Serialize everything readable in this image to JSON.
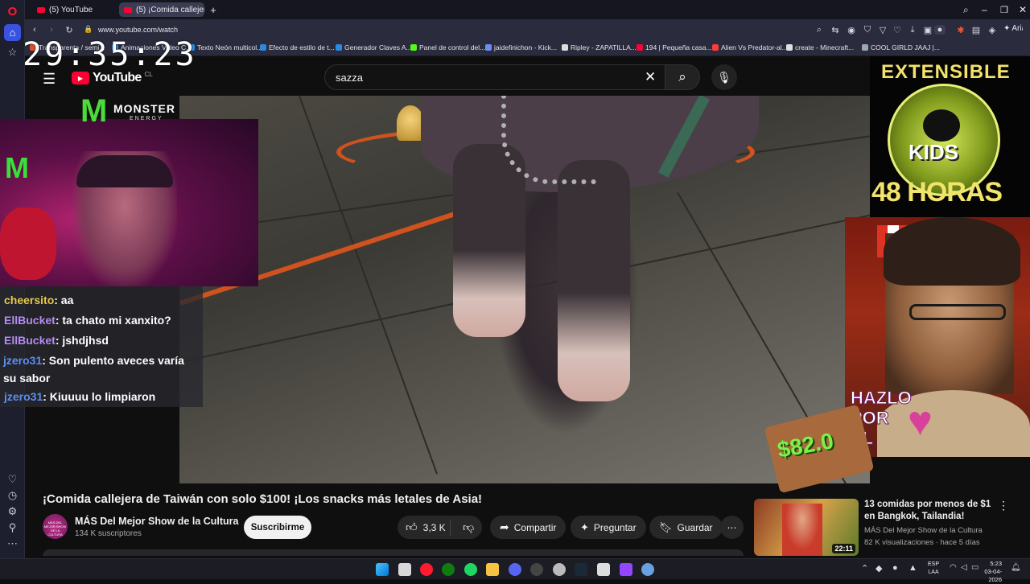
{
  "browser": {
    "tabs": [
      {
        "label": "(5) YouTube",
        "active": false
      },
      {
        "label": "(5) ¡Comida callejera ...",
        "active": true
      }
    ],
    "url": "www.youtube.com/watch",
    "bookmarks": [
      "Transparenta / semi...",
      "Animaciones Video C...",
      "Texto Neón multicol...",
      "Efecto de estilo de t...",
      "Generador Claves A...",
      "Panel de control del...",
      "jaidefinichon - Kick...",
      "Ripley - ZAPATILLA...",
      "194 | Pequeña casa...",
      "Alien Vs Predator-al...",
      "create - Minecraft...",
      "COOL GIRLD JAAJ |..."
    ],
    "ai_label": "Aria"
  },
  "overlay": {
    "clock": "29:35:23",
    "sponsor": "MONSTER",
    "sponsor_sub": "ENERGY",
    "kids_top": "EXTENSIBLE",
    "kids_mid": "KIDS",
    "kids_bottom": "48 HORAS",
    "hazlo": [
      "HAZLO",
      "POR",
      "EL"
    ],
    "money": "$82.0"
  },
  "chat": [
    {
      "user": "cheersito",
      "color": "#e6c84a",
      "text": ": aa"
    },
    {
      "user": "EllBucket",
      "color": "#b58cf0",
      "text": ": ta chato mi xanxito?"
    },
    {
      "user": "EllBucket",
      "color": "#b58cf0",
      "text": ": jshdjhsd"
    },
    {
      "user": "jzero31",
      "color": "#5b8ff0",
      "text": ": Son pulento aveces varía su sabor"
    },
    {
      "user": "jzero31",
      "color": "#5b8ff0",
      "text": ": Kiuuuu lo limpiaron"
    }
  ],
  "youtube": {
    "logo": "YouTube",
    "country": "CL",
    "search_value": "sazza",
    "video_title": "¡Comida callejera de Taiwán con solo $100! ¡Los snacks más letales de Asia!",
    "channel": "MÁS Del Mejor Show de la Cultura",
    "subscribers": "134 K suscriptores",
    "avatar_text": "MÁS DEL MEJOR SHOW DE LA CULTURA",
    "subscribe": "Suscribirme",
    "likes": "3,3 K",
    "share": "Compartir",
    "ask": "Preguntar",
    "save": "Guardar",
    "related": {
      "title": "13 comidas por menos de $1 en Bangkok, Tailandia!",
      "channel": "MÁS Del Mejor Show de la Cultura",
      "meta": "82 K visualizaciones · hace 5 días",
      "duration": "22:11"
    }
  },
  "taskbar": {
    "lang": "ESP",
    "region": "LAA",
    "time": "5:23",
    "date": "03-04-2026"
  },
  "colors": {
    "accent_red": "#ff0033",
    "brand_opera": "#ff1b2d",
    "chat_bg": "#28282e"
  }
}
